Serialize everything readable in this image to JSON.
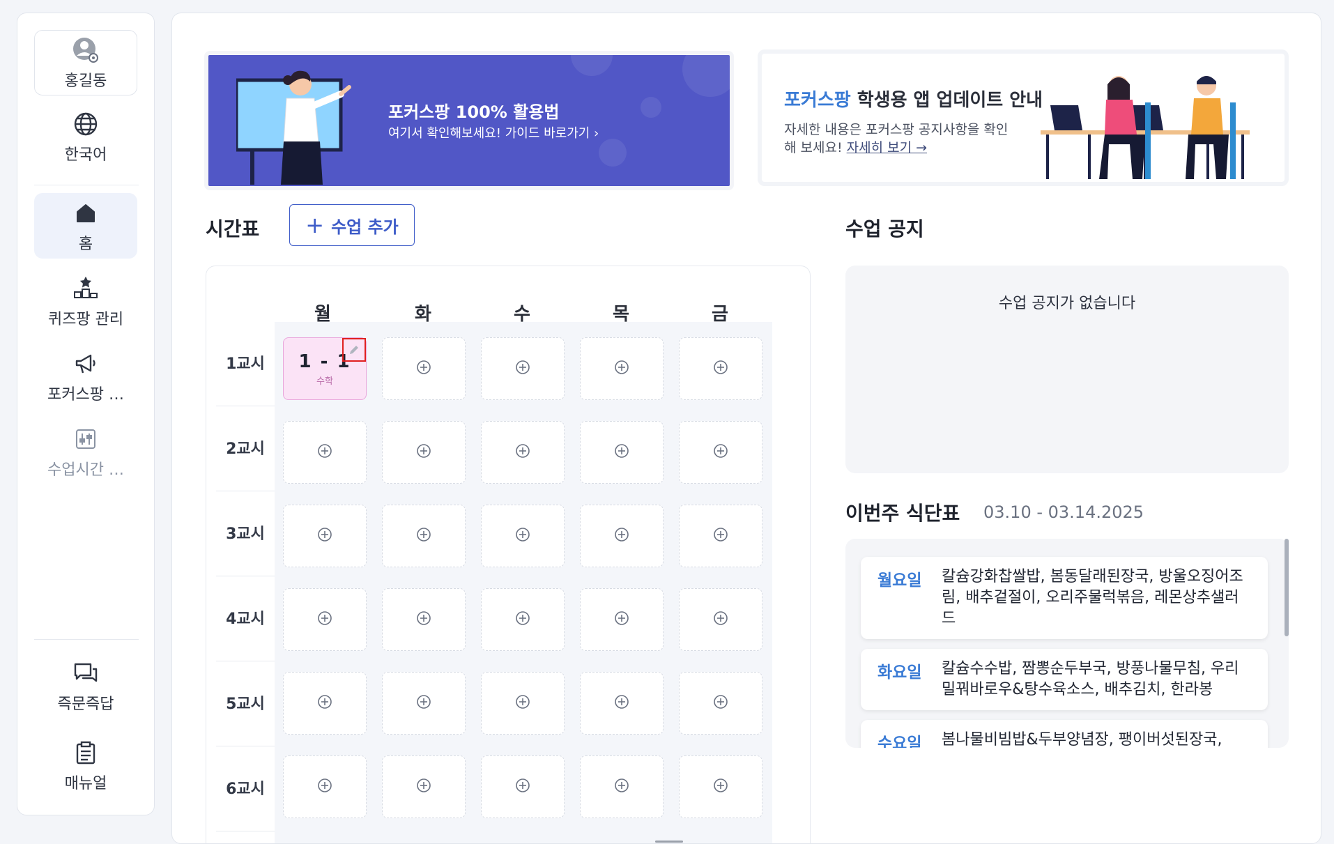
{
  "sidebar": {
    "profile": {
      "name": "홍길동",
      "icon": "user-settings-icon"
    },
    "language": {
      "label": "한국어",
      "icon": "globe-icon"
    },
    "items": [
      {
        "label": "홈",
        "icon": "home-icon",
        "active": true
      },
      {
        "label": "퀴즈팡 관리",
        "icon": "quiz-blocks-icon"
      },
      {
        "label": "포커스팡 …",
        "icon": "megaphone-icon"
      },
      {
        "label": "수업시간 …",
        "icon": "sliders-icon",
        "dim": true
      }
    ],
    "bottom": [
      {
        "label": "즉문즉답",
        "icon": "chat-icon"
      },
      {
        "label": "매뉴얼",
        "icon": "clipboard-icon"
      }
    ]
  },
  "banners": {
    "guide": {
      "title": "포커스팡 100% 활용법",
      "subtitle": "여기서 확인해보세요! 가이드 바로가기 ›",
      "color": "#5157c6"
    },
    "update": {
      "title_highlight": "포커스팡",
      "title_rest": " 학생용 앱 업데이트 안내",
      "subtitle": "자세한 내용은 포커스팡 공지사항을 확인해 보세요! ",
      "link": "자세히 보기 →"
    }
  },
  "timetable": {
    "title": "시간표",
    "add_button": "수업 추가",
    "days": [
      "월",
      "화",
      "수",
      "목",
      "금"
    ],
    "periods": [
      "1교시",
      "2교시",
      "3교시",
      "4교시",
      "5교시",
      "6교시"
    ],
    "filled": {
      "name": "1 - 1",
      "subject": "수학"
    }
  },
  "notice": {
    "title": "수업 공지",
    "empty": "수업 공지가 없습니다"
  },
  "menu": {
    "title": "이번주 식단표",
    "range": "03.10 - 03.14.2025",
    "days": [
      {
        "day": "월요일",
        "items": "칼슘강화찹쌀밥, 봄동달래된장국, 방울오징어조림, 배추겉절이, 오리주물럭볶음, 레몬상추샐러드"
      },
      {
        "day": "화요일",
        "items": "칼슘수수밥, 짬뽕순두부국, 방풍나물무침, 우리밀꿔바로우&탕수육소스, 배추김치, 한라봉"
      },
      {
        "day": "수요일",
        "items": "봄나물비빔밥&두부양념장, 팽이버섯된장국,"
      }
    ]
  },
  "colors": {
    "accent": "#3e5cc8",
    "highlight": "#3a7bd5",
    "filled_cell": "#fbe3f6"
  }
}
